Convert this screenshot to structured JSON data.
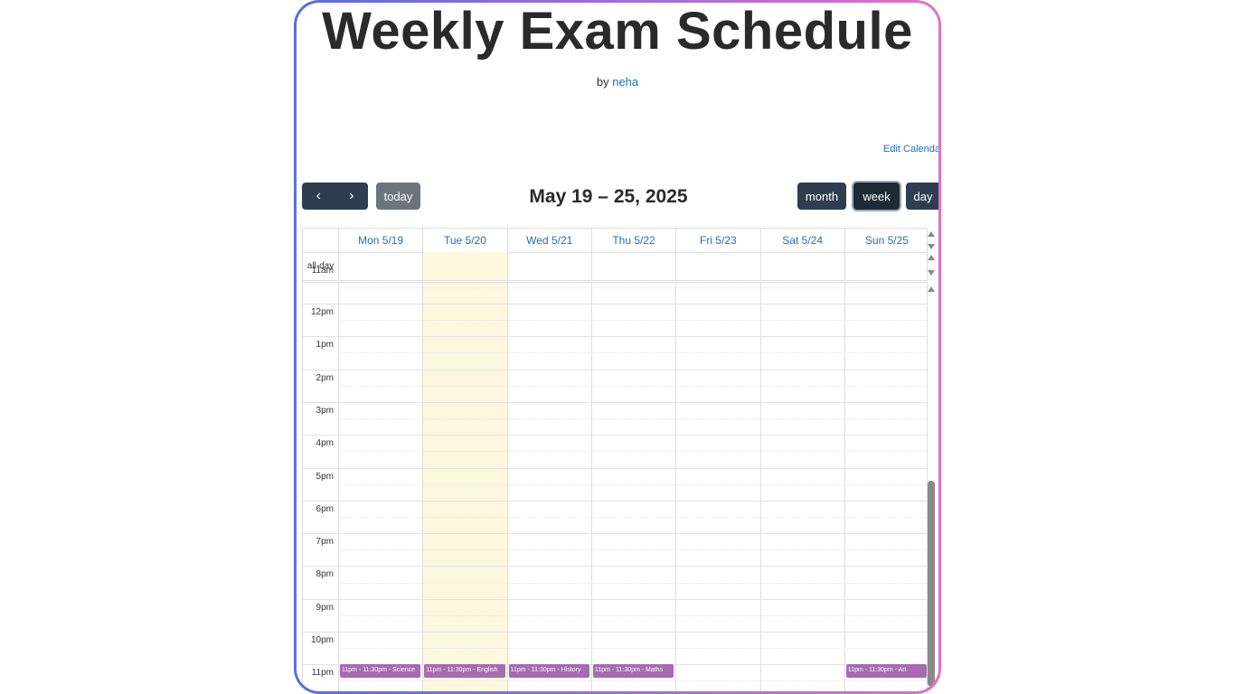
{
  "page": {
    "title": "Weekly Exam Schedule",
    "byline_prefix": "by",
    "author": "neha",
    "edit_link": "Edit Calenda"
  },
  "toolbar": {
    "prev_icon": "chevron-left-icon",
    "next_icon": "chevron-right-icon",
    "prev_glyph": "‹",
    "next_glyph": "›",
    "today_label": "today",
    "range_title": "May 19 – 25, 2025",
    "views": {
      "month": "month",
      "week": "week",
      "day": "day"
    },
    "active_view": "week"
  },
  "calendar": {
    "allday_label": "all-day",
    "days": [
      {
        "label": "Mon 5/19"
      },
      {
        "label": "Tue 5/20",
        "today": true
      },
      {
        "label": "Wed 5/21"
      },
      {
        "label": "Thu 5/22"
      },
      {
        "label": "Fri 5/23"
      },
      {
        "label": "Sat 5/24"
      },
      {
        "label": "Sun 5/25"
      }
    ],
    "partial_label": "11am",
    "times": [
      "12pm",
      "1pm",
      "2pm",
      "3pm",
      "4pm",
      "5pm",
      "6pm",
      "7pm",
      "8pm",
      "9pm",
      "10pm",
      "11pm"
    ],
    "events": [
      {
        "day": 0,
        "text": "11pm - 11:30pm - Science"
      },
      {
        "day": 1,
        "text": "11pm - 11:30pm - English"
      },
      {
        "day": 2,
        "text": "11pm - 11:30pm - History"
      },
      {
        "day": 3,
        "text": "11pm - 11:30pm - Maths"
      },
      {
        "day": 6,
        "text": "11pm - 11:30pm - Art"
      }
    ],
    "colors": {
      "event": "#a66bb1",
      "today_bg": "#fdf7de",
      "button": "#2c3e50",
      "link": "#1f6fb5"
    }
  }
}
